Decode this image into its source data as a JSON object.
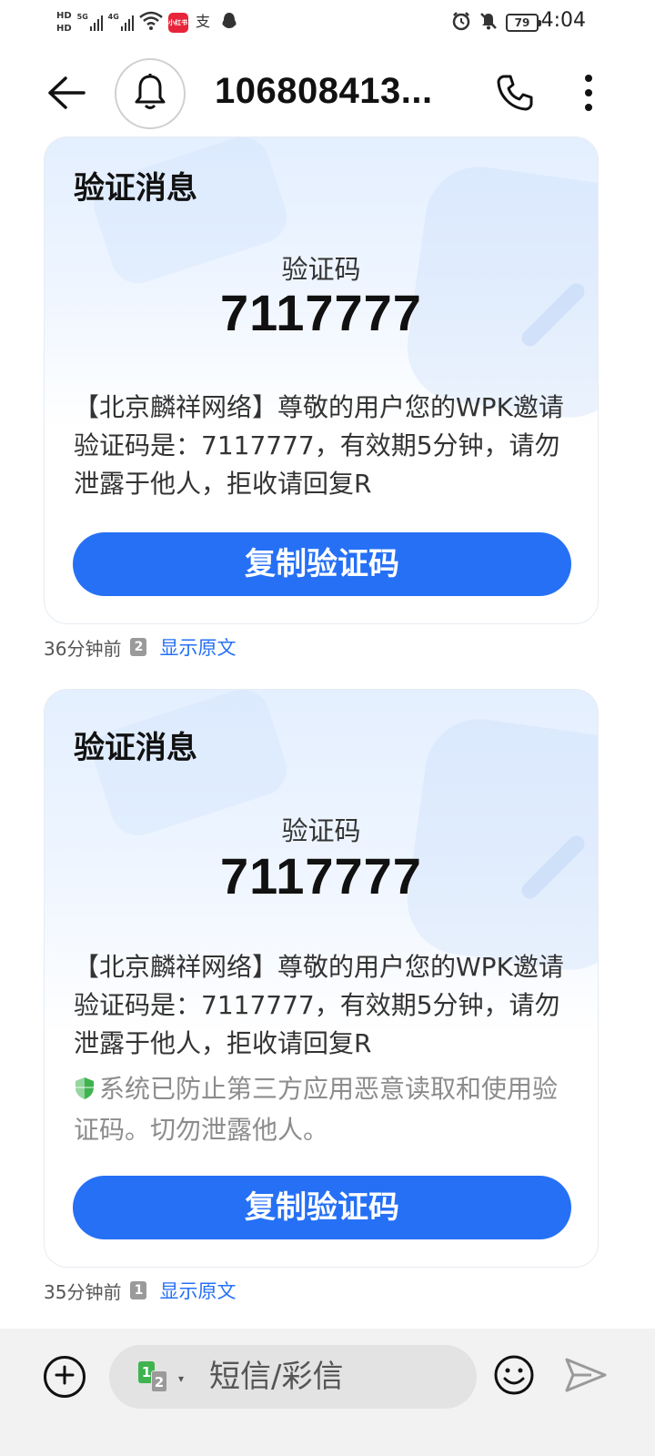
{
  "status_bar": {
    "hd_top": "HD",
    "hd_bottom": "HD",
    "network_1": "5G",
    "network_2": "4G",
    "app_badge": "小红书",
    "battery": "79",
    "time": "4:04",
    "icons": [
      "signal-icon",
      "wifi-icon",
      "alipay-icon",
      "qq-icon",
      "alarm-icon",
      "mute-icon",
      "battery-icon"
    ]
  },
  "header": {
    "contact": "106808413..."
  },
  "messages": [
    {
      "card_title": "验证消息",
      "code_label": "验证码",
      "code": "7117777",
      "body": "【北京麟祥网络】尊敬的用户您的WPK邀请验证码是：7117777，有效期5分钟，请勿泄露于他人，拒收请回复R",
      "button": "复制验证码",
      "time": "36分钟前",
      "sim": "2",
      "show_original": "显示原文"
    },
    {
      "card_title": "验证消息",
      "code_label": "验证码",
      "code": "7117777",
      "body": "【北京麟祥网络】尊敬的用户您的WPK邀请验证码是：7117777，有效期5分钟，请勿泄露于他人，拒收请回复R",
      "security_note": "系统已防止第三方应用恶意读取和使用验证码。切勿泄露他人。",
      "button": "复制验证码",
      "time": "35分钟前",
      "sim": "1",
      "show_original": "显示原文"
    }
  ],
  "composer": {
    "placeholder": "短信/彩信",
    "sim_primary": "1",
    "sim_secondary": "2"
  },
  "colors": {
    "accent": "#2670f5",
    "sim_active": "#3fb34f",
    "shield": "#3fb34f"
  }
}
